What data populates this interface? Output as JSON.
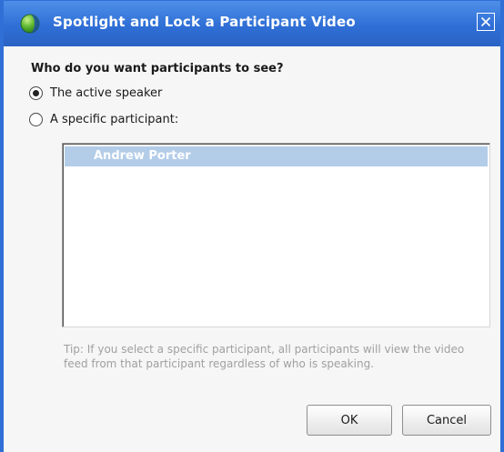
{
  "window": {
    "title": "Spotlight and Lock a Participant Video",
    "icon": "globe-icon",
    "close_icon": "close-icon",
    "accent_color": "#2f6fd6"
  },
  "question": "Who do you want participants to see?",
  "options": [
    {
      "label": "The active speaker",
      "selected": true
    },
    {
      "label": "A specific participant:",
      "selected": false
    }
  ],
  "participants": [
    {
      "name": "Andrew Porter",
      "highlighted": true
    }
  ],
  "tip": "Tip: If you select a specific participant, all participants will view the video feed from that participant regardless of who is speaking.",
  "buttons": {
    "ok": "OK",
    "cancel": "Cancel"
  }
}
